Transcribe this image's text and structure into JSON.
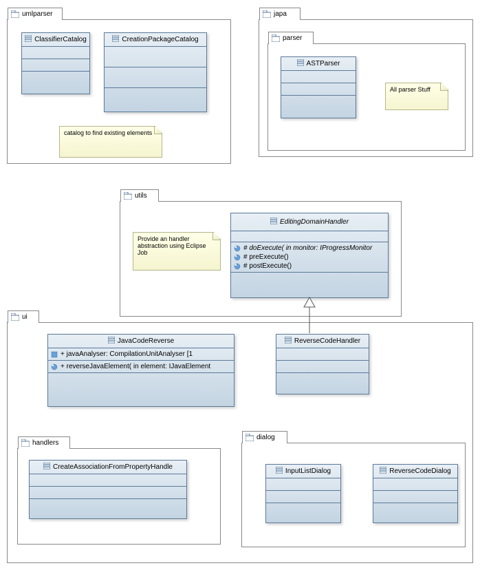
{
  "packages": {
    "umlparser": {
      "label": "umlparser"
    },
    "japa": {
      "label": "japa"
    },
    "parser": {
      "label": "parser"
    },
    "utils": {
      "label": "utils"
    },
    "ui": {
      "label": "ui"
    },
    "handlers": {
      "label": "handlers"
    },
    "dialog": {
      "label": "dialog"
    }
  },
  "classes": {
    "ClassifierCatalog": {
      "name": "ClassifierCatalog"
    },
    "CreationPackageCatalog": {
      "name": "CreationPackageCatalog"
    },
    "ASTParser": {
      "name": "ASTParser"
    },
    "EditingDomainHandler": {
      "name": "EditingDomainHandler",
      "ops": [
        "# doExecute(  in monitor: IProgressMonitor",
        "# preExecute()",
        "# postExecute()"
      ]
    },
    "JavaCodeReverse": {
      "name": "JavaCodeReverse",
      "attrs": [
        "+ javaAnalyser: CompilationUnitAnalyser [1"
      ],
      "ops": [
        "+ reverseJavaElement(  in element: IJavaElement"
      ]
    },
    "ReverseCodeHandler": {
      "name": "ReverseCodeHandler"
    },
    "CreateAssociationFromPropertyHandler": {
      "name": "CreateAssociationFromPropertyHandle"
    },
    "InputListDialog": {
      "name": "InputListDialog"
    },
    "ReverseCodeDialog": {
      "name": "ReverseCodeDialog"
    }
  },
  "notes": {
    "catalog": "catalog to find existing elements",
    "parserStuff": "All parser Stuff",
    "handlerAbstraction": "Provide an handler abstraction using Eclipse Job"
  }
}
